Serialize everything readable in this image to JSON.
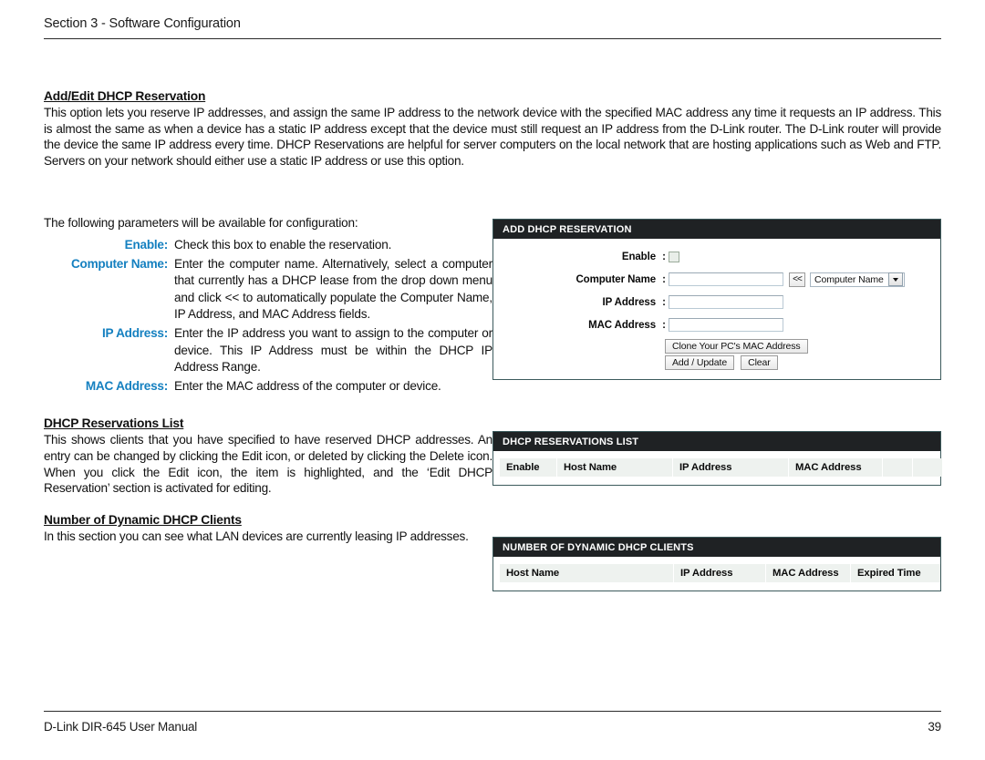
{
  "header": {
    "section_label": "Section 3 - Software Configuration"
  },
  "intro": {
    "title": "Add/Edit DHCP Reservation",
    "paragraph": "This option lets you reserve IP addresses, and assign the same IP address to the network device with the specified MAC address any time it requests an IP address. This is almost the same as when a device has a static IP address except that the device must still request an IP address from the D-Link router. The D-Link router will provide the device the same IP address every time. DHCP Reservations are helpful for server computers on the local network that are hosting applications such as Web and FTP. Servers on your network should either use a static IP address or use this option."
  },
  "parameters": {
    "lead_in": "The following parameters will be available for configuration:",
    "items": [
      {
        "label": "Enable:",
        "description": "Check this box to enable the reservation."
      },
      {
        "label": "Computer Name:",
        "description": "Enter the computer name. Alternatively, select a computer that currently has a DHCP lease from the drop down menu and click << to automatically populate the Computer Name, IP Address, and MAC Address fields."
      },
      {
        "label": "IP Address:",
        "description": "Enter the IP address you want to assign to the computer or device. This IP Address must be within the DHCP IP Address Range."
      },
      {
        "label": "MAC Address:",
        "description": "Enter the MAC address of the computer or device."
      }
    ]
  },
  "reservations_section": {
    "title": "DHCP Reservations List",
    "paragraph": "This shows clients that you have specified to have reserved DHCP addresses. An entry can be changed by clicking the Edit icon, or deleted by clicking the Delete icon. When you click the Edit icon, the item is highlighted, and the ‘Edit DHCP Reservation’ section is activated for editing."
  },
  "dynamic_section": {
    "title": "Number of Dynamic DHCP Clients",
    "paragraph": "In this section you can see what LAN devices are currently leasing IP addresses."
  },
  "panels": {
    "add_reservation": {
      "title": "ADD DHCP RESERVATION",
      "fields": {
        "enable_label": "Enable",
        "computer_name_label": "Computer Name",
        "ip_address_label": "IP Address",
        "mac_address_label": "MAC Address",
        "colon": ":",
        "computer_name_value": "",
        "ip_address_value": "",
        "mac_address_value": "",
        "enable_checked": false
      },
      "copy_button_label": "<<",
      "select": {
        "selected": "Computer Name"
      },
      "buttons": {
        "clone": "Clone Your PC's MAC Address",
        "add_update": "Add / Update",
        "clear": "Clear"
      }
    },
    "reservations_list": {
      "title": "DHCP RESERVATIONS LIST",
      "columns": [
        "Enable",
        "Host Name",
        "IP Address",
        "MAC Address",
        "",
        ""
      ],
      "rows": []
    },
    "dynamic_clients": {
      "title": "NUMBER OF DYNAMIC DHCP CLIENTS",
      "columns": [
        "Host Name",
        "IP Address",
        "MAC Address",
        "Expired Time"
      ],
      "rows": []
    }
  },
  "footer": {
    "manual_title": "D-Link DIR-645 User Manual",
    "page_number": "39"
  },
  "colors": {
    "param_label": "#1580c0",
    "panel_titlebar": "#1f2224",
    "panel_border": "#3c5a5c",
    "table_header_bg": "#eef2ef"
  }
}
